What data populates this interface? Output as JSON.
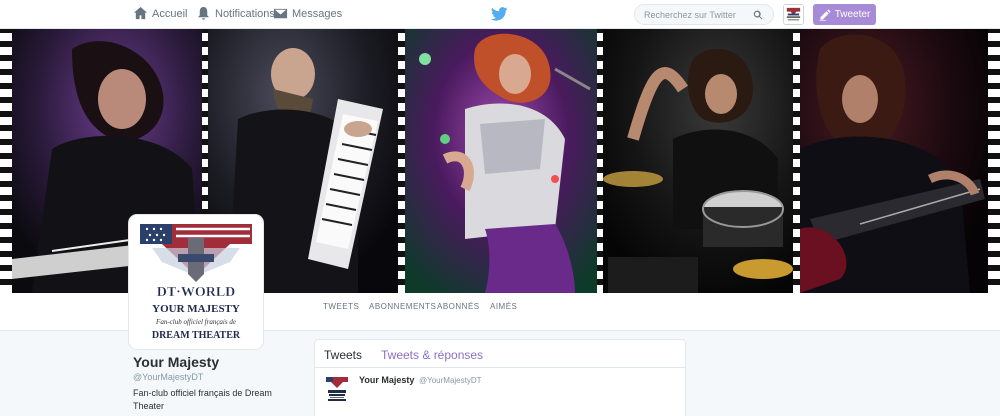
{
  "topnav": {
    "home_label": "Accueil",
    "notifications_label": "Notifications",
    "messages_label": "Messages",
    "search_placeholder": "Recherchez sur Twitter",
    "tweet_button_label": "Tweeter"
  },
  "profile_nav": {
    "items": [
      "TWEETS",
      "ABONNEMENTS",
      "ABONNÉS",
      "AIMÉS"
    ]
  },
  "profile": {
    "name": "Your Majesty",
    "handle": "@YourMajestyDT",
    "bio": "Fan-club officiel français de Dream Theater",
    "logo_text": {
      "line1": "DT·WORLD",
      "line2": "YOUR MAJESTY",
      "line3": "Fan-club officiel français de",
      "line4": "DREAM THEATER"
    }
  },
  "timeline": {
    "tabs": [
      "Tweets",
      "Tweets & réponses"
    ],
    "tweet": {
      "name": "Your Majesty",
      "handle": "@YourMajestyDT"
    }
  },
  "colors": {
    "accent": "#a88bd6",
    "tab_link": "#8b6fc4",
    "twitter_blue": "#55acee"
  }
}
